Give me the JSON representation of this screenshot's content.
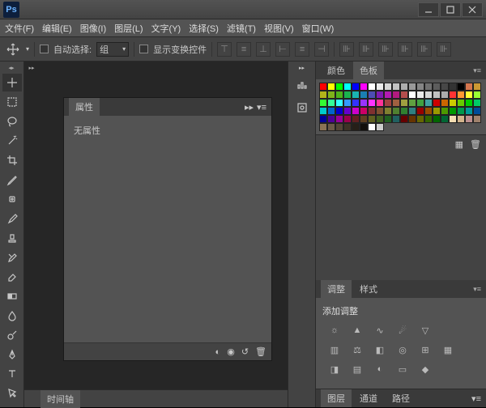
{
  "app": {
    "logo": "Ps"
  },
  "menubar": {
    "items": [
      {
        "label": "文件(F)"
      },
      {
        "label": "编辑(E)"
      },
      {
        "label": "图像(I)"
      },
      {
        "label": "图层(L)"
      },
      {
        "label": "文字(Y)"
      },
      {
        "label": "选择(S)"
      },
      {
        "label": "滤镜(T)"
      },
      {
        "label": "视图(V)"
      },
      {
        "label": "窗口(W)"
      }
    ]
  },
  "options": {
    "auto_select_label": "自动选择:",
    "group_label": "组",
    "show_transform_label": "显示变换控件"
  },
  "panels": {
    "color": {
      "tab_color": "颜色",
      "tab_swatches": "色板"
    },
    "swatches_colors": [
      "#ff0000",
      "#ffff00",
      "#00ff00",
      "#00ffff",
      "#0000ff",
      "#ff00ff",
      "#ffffff",
      "#ebebeb",
      "#d6d6d6",
      "#c2c2c2",
      "#adadad",
      "#999999",
      "#858585",
      "#707070",
      "#5c5c5c",
      "#474747",
      "#333333",
      "#000000",
      "#d4764f",
      "#cc9933",
      "#b3b31a",
      "#7fb31a",
      "#4db31a",
      "#1ab34d",
      "#1ab3b3",
      "#1a7fb3",
      "#4d4db3",
      "#7f1ab3",
      "#b31ab3",
      "#b31a7f",
      "#b34d4d",
      "#ffffff",
      "#ebebeb",
      "#d6d6d6",
      "#c2c2c2",
      "#adadad",
      "#ff3333",
      "#ff9933",
      "#ffff33",
      "#99ff33",
      "#33ff33",
      "#33ff99",
      "#33ffff",
      "#3399ff",
      "#3333ff",
      "#9933ff",
      "#ff33ff",
      "#ff3399",
      "#a04040",
      "#a06040",
      "#a0a040",
      "#60a040",
      "#40a040",
      "#40a0a0",
      "#cc0000",
      "#cc6600",
      "#cccc00",
      "#66cc00",
      "#00cc00",
      "#00cc66",
      "#00cccc",
      "#0066cc",
      "#0000cc",
      "#6600cc",
      "#cc00cc",
      "#cc0066",
      "#803030",
      "#805030",
      "#808030",
      "#508030",
      "#308030",
      "#308080",
      "#990000",
      "#994c00",
      "#999900",
      "#4c9900",
      "#009900",
      "#00994c",
      "#009999",
      "#004c99",
      "#000099",
      "#4c0099",
      "#990099",
      "#99004c",
      "#602020",
      "#604020",
      "#606020",
      "#406020",
      "#206020",
      "#206060",
      "#660000",
      "#663300",
      "#666600",
      "#336600",
      "#006600",
      "#006633",
      "#f5deb3",
      "#d2b48c",
      "#bc8f8f",
      "#a0826d",
      "#8b7355",
      "#6b5a47",
      "#544536",
      "#3d3226",
      "#261f18",
      "#13100c",
      "#ffffff",
      "#cccccc"
    ],
    "properties": {
      "tab": "属性",
      "no_properties": "无属性"
    },
    "timeline": {
      "tab": "时间轴"
    },
    "adjustments": {
      "tab_adjust": "调整",
      "tab_styles": "样式",
      "add_label": "添加调整"
    },
    "layers": {
      "tab_layers": "图层",
      "tab_channels": "通道",
      "tab_paths": "路径"
    }
  }
}
